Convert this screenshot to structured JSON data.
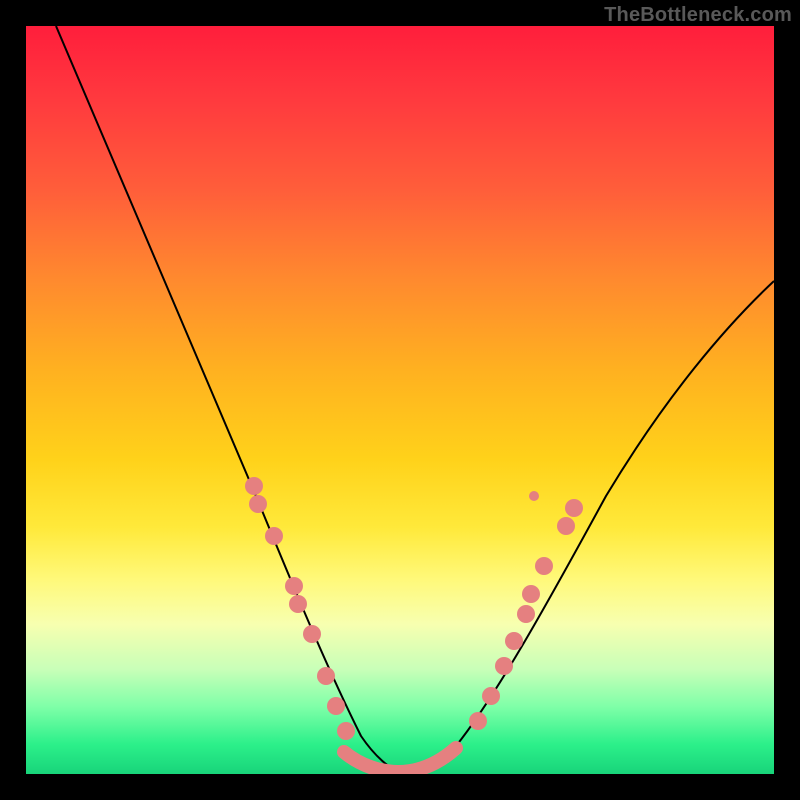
{
  "watermark": {
    "text": "TheBottleneck.com"
  },
  "colors": {
    "marker": "#e58080",
    "curve": "#000000",
    "background_black": "#000000"
  },
  "chart_data": {
    "type": "line",
    "title": "",
    "xlabel": "",
    "ylabel": "",
    "xlim": [
      0,
      100
    ],
    "ylim": [
      0,
      100
    ],
    "grid": false,
    "legend": false,
    "note": "V-shaped bottleneck curve over a red→green vertical gradient. Values estimated from pixel positions; y = 0 is bottom (green), y = 100 is top (red).",
    "series": [
      {
        "name": "curve",
        "x": [
          4,
          8,
          12,
          16,
          20,
          24,
          28,
          31,
          34,
          37,
          40,
          43,
          46,
          49,
          52,
          55,
          58,
          62,
          66,
          72,
          78,
          84,
          90,
          96,
          100
        ],
        "y": [
          100,
          92,
          83,
          74,
          65,
          55,
          44,
          34,
          24,
          15,
          8,
          3,
          0.5,
          0,
          0.5,
          3,
          8,
          16,
          25,
          36,
          46,
          53,
          59,
          63,
          66
        ],
        "style": "line"
      },
      {
        "name": "markers",
        "x": [
          30.5,
          33,
          36,
          38,
          40.5,
          43,
          62,
          63.5,
          65,
          67,
          69.5,
          72.5
        ],
        "y": [
          38.5,
          32,
          23,
          17,
          11,
          6,
          20,
          23,
          26,
          29.5,
          33,
          38
        ],
        "style": "scatter"
      },
      {
        "name": "trough_segment",
        "x": [
          43,
          46,
          49,
          52,
          55,
          58
        ],
        "y": [
          3,
          1,
          0.5,
          0.5,
          1,
          3
        ],
        "style": "thick-line"
      }
    ]
  }
}
